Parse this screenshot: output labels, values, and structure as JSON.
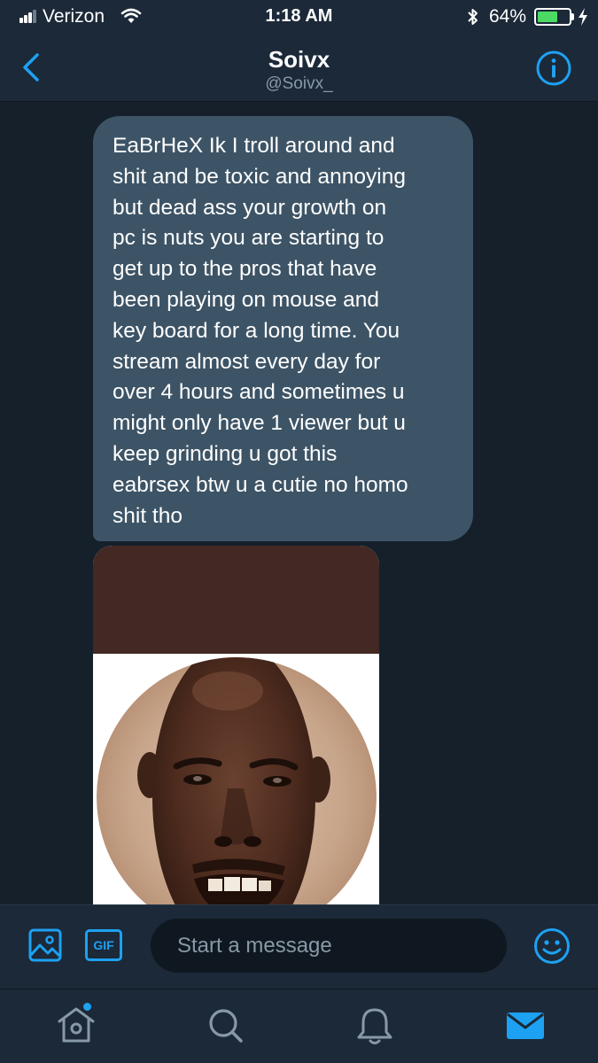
{
  "status_bar": {
    "carrier": "Verizon",
    "time": "1:18 AM",
    "battery_percent": "64%",
    "battery_level": 0.64
  },
  "header": {
    "title": "Soivx",
    "handle": "@Soivx_"
  },
  "conversation": {
    "messages": [
      {
        "type": "text",
        "text": "EaBrHeX Ik I troll around and\nshit and be toxic and annoying\nbut dead ass your growth on\npc is nuts you are starting to\nget up to the pros that have\nbeen playing on mouse and\nkey board for a long time. You\nstream almost every day for\nover 4 hours and sometimes u\nmight only have 1 viewer but u\nkeep grinding u got this\neabrsex btw u a cutie no homo\nshit tho"
      },
      {
        "type": "image"
      }
    ]
  },
  "composer": {
    "gif_label": "GIF",
    "placeholder": "Start a message"
  },
  "tabbar": {
    "items": [
      "home",
      "search",
      "notifications",
      "messages"
    ],
    "active": "messages"
  },
  "colors": {
    "accent": "#1da1f2",
    "background": "#15202b",
    "bar": "#1c2938",
    "bubble": "#3d5466",
    "battery": "#4cd964"
  },
  "icons": {
    "back": "chevron-left-icon",
    "info": "info-icon",
    "image": "image-icon",
    "emoji": "smiley-icon",
    "home": "home-icon",
    "search": "search-icon",
    "notifications": "bell-icon",
    "messages": "envelope-icon"
  }
}
